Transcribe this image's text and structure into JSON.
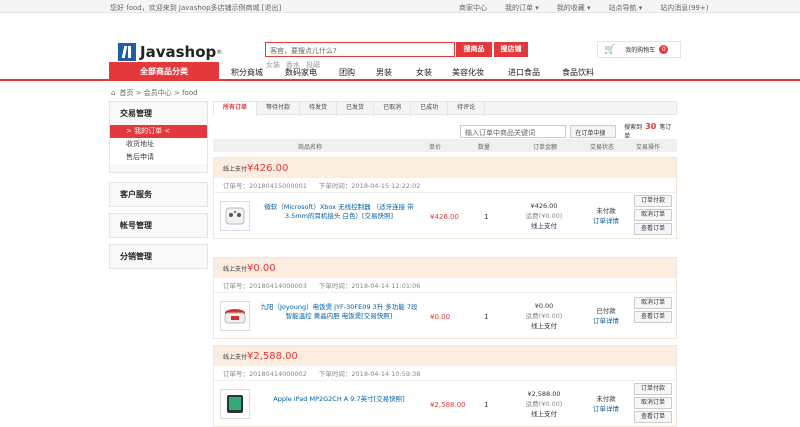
{
  "topbar": {
    "welcome": "您好 food，欢迎来到 Javashop多店铺示例商城 [退出]",
    "links": [
      "商家中心",
      "我的订单 ▾",
      "我的收藏 ▾",
      "站点导航 ▾",
      "站内消息(99+)"
    ]
  },
  "header": {
    "logo_text": "Javashop",
    "logo_sup": "®",
    "search_placeholder": "客官，要搜点儿什么?",
    "btn_goods": "搜商品",
    "btn_shop": "搜店铺",
    "hotwords": [
      "女装",
      "香水",
      "投磁"
    ],
    "cart_label": "我的购物车",
    "cart_count": "0"
  },
  "nav": {
    "all": "全部商品分类",
    "items": [
      "积分商城",
      "数码家电",
      "团购",
      "男装",
      "女装",
      "美容化妆",
      "进口食品",
      "食品饮料"
    ]
  },
  "breadcrumb": "首页 > 会员中心 > food",
  "sidebar": {
    "groups": [
      {
        "title": "交易管理",
        "items": [
          {
            "label": "> 我的订单 <",
            "active": true
          },
          {
            "label": "收货地址",
            "active": false
          },
          {
            "label": "售后申请",
            "active": false
          }
        ]
      },
      {
        "title": "客户服务",
        "items": []
      },
      {
        "title": "帐号管理",
        "items": []
      },
      {
        "title": "分销管理",
        "items": []
      }
    ]
  },
  "tabs": [
    "所有订单",
    "等待付款",
    "待发货",
    "已发货",
    "已取消",
    "已成功",
    "待评论"
  ],
  "filter": {
    "placeholder": "输入订单中商品关键词",
    "btn": "在订单中搜索",
    "count_prefix": "搜索到",
    "count": "30",
    "count_suffix": "笔订单"
  },
  "thead": {
    "name": "商品名称",
    "price": "单价",
    "qty": "数量",
    "amount": "订单金额",
    "status": "交易状态",
    "ops": "交易操作"
  },
  "orders": [
    {
      "paytype": "线上支付",
      "amount": "¥426.00",
      "orderno": "订单号：20180415000001",
      "time": "下单时间：2018-04-15 12:22:02",
      "product": "微软（Microsoft）Xbox 无线控制器 （适牙连接 带3.5mm的耳机接头 白色）[交易快照]",
      "price": "¥426.00",
      "qty": "1",
      "total": "¥426.00",
      "freight": "运费(¥0.00)",
      "pay": "线上支付",
      "status": "未付款",
      "detail": "订单详情",
      "ops": [
        "订单付款",
        "取消订单",
        "查看订单"
      ]
    },
    {
      "paytype": "线上支付",
      "amount": "¥0.00",
      "orderno": "订单号：20180414000003",
      "time": "下单时间：2018-04-14 11:01:06",
      "product": "九阳（Joyoung）电饭煲 JYF-30FE09 3升 多功能 7段智能温控 黄晶内胆 电饭煲[交易快照]",
      "price": "¥0.00",
      "qty": "1",
      "total": "¥0.00",
      "freight": "运费(¥0.00)",
      "pay": "线上支付",
      "status": "已付款",
      "detail": "订单详情",
      "ops": [
        "取消订单",
        "查看订单"
      ]
    },
    {
      "paytype": "线上支付",
      "amount": "¥2,588.00",
      "orderno": "订单号：20180414000002",
      "time": "下单时间：2018-04-14 10:59:38",
      "product": "Apple iPad MP2G2CH A 9.7英寸[交易快照]",
      "price": "¥2,588.00",
      "qty": "1",
      "total": "¥2,588.00",
      "freight": "运费(¥0.00)",
      "pay": "线上支付",
      "status": "未付款",
      "detail": "订单详情",
      "ops": [
        "订单付款",
        "取消订单",
        "查看订单"
      ]
    }
  ]
}
